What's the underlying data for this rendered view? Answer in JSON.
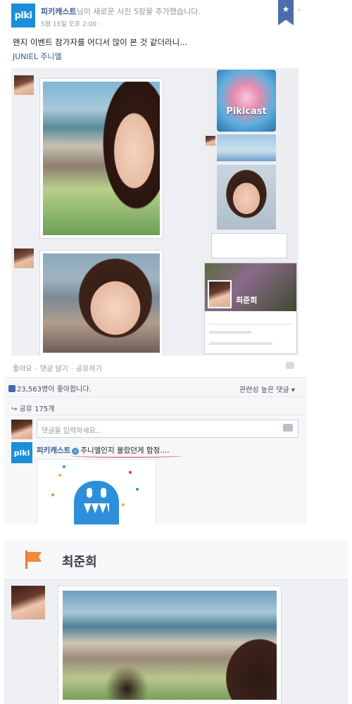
{
  "post": {
    "page_logo": "piki",
    "page_name": "피키캐스트",
    "header_rest": "님이 새로운 사진 5장을 추가했습니다.",
    "timestamp": "5월 15일 오후 2:00 ·",
    "message": "왠지 이벤트 참가자를 어디서 많이 본 것 같더라니...",
    "tagline": "JUNIEL 주니엘",
    "bookmark_icon": "star-icon",
    "inner_screenshot": {
      "pikicast_label": "Pikicast",
      "profile_name": "최준희"
    },
    "actions": [
      "좋아요",
      "·",
      "댓글 달기",
      "·",
      "공유하기"
    ],
    "likes_text": "23,563명이 좋아합니다.",
    "sort_label": "관련성 높은 댓글 ▾",
    "shares_text": "공유 175개",
    "comment_placeholder": "댓글을 입력하세요...",
    "reply": {
      "logo": "piki",
      "name": "피키캐스트",
      "text": "주니엘인지 물랐던게 함정...."
    }
  },
  "profile_panel": {
    "title": "최준희"
  },
  "colors": {
    "brand_blue": "#1a8fd8",
    "link_blue": "#365899",
    "bookmark_blue": "#4a6ea9",
    "flag_orange": "#f08a3a",
    "underline_red": "#e0393e"
  }
}
